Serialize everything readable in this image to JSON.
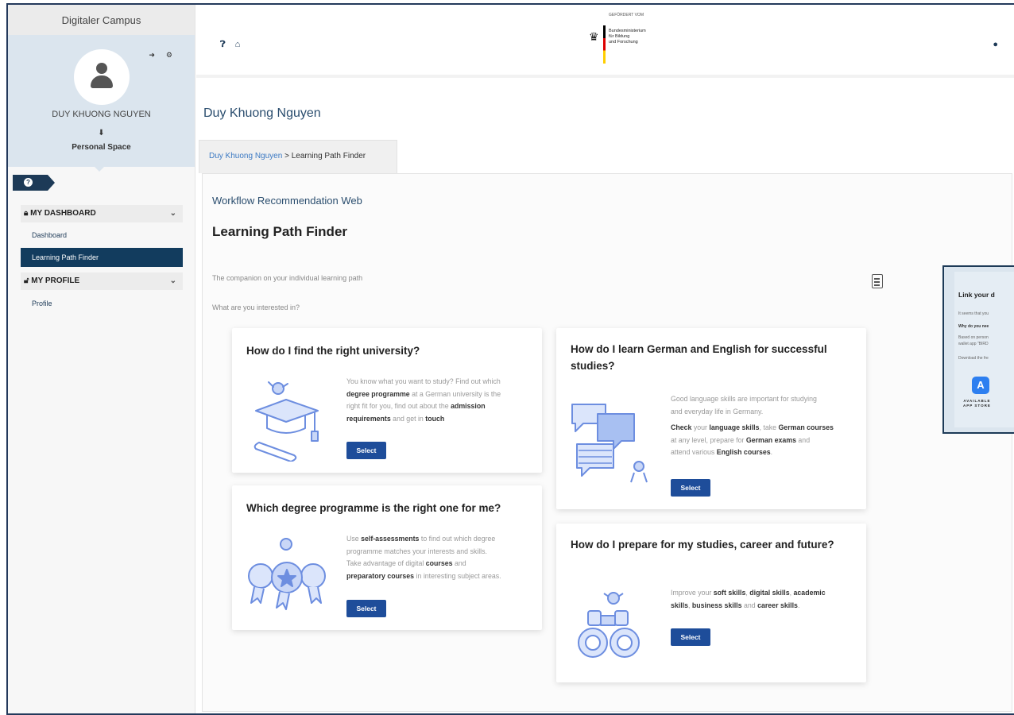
{
  "sidebar": {
    "campus_title": "Digitaler Campus",
    "user_name": "DUY KHUONG NGUYEN",
    "personal_space": "Personal Space",
    "my_dashboard": "MY DASHBOARD",
    "dashboard": "Dashboard",
    "learning_path_finder": "Learning Path Finder",
    "my_profile": "MY PROFILE",
    "profile": "Profile"
  },
  "header": {
    "sponsor_caption": "GEFÖRDERT VOM",
    "ministry_line1": "Bundesministerium",
    "ministry_line2": "für Bildung",
    "ministry_line3": "und Forschung"
  },
  "page": {
    "title": "Duy Khuong Nguyen",
    "breadcrumb_link": "Duy Khuong Nguyen",
    "breadcrumb_sep": " > ",
    "breadcrumb_current": "Learning Path Finder",
    "workflow_title": "Workflow Recommendation Web",
    "heading": "Learning Path Finder",
    "companion": "The companion on your individual learning path",
    "question": "What are you interested in?"
  },
  "cards": [
    {
      "title": "How do I find the right university?",
      "t1": "You know what you want to study? Find out which",
      "t2b": "degree programme",
      "t2": " at a German university is the",
      "t3": "right fit for you, find out about the ",
      "t3b": "admission",
      "t4b": "requirements",
      "t4": " and get in ",
      "t4c": "touch",
      "button": "Select"
    },
    {
      "title": "How do I learn German and English for successful studies?",
      "t1": "Good language skills are important for studying",
      "t2": "and everyday life in Germany.",
      "t3b": "Check",
      "t3": " your ",
      "t3c": "language skills",
      "t3d": ", take ",
      "t3e": "German courses",
      "t4": "at any level, prepare for ",
      "t4b": "German exams",
      "t4c": " and",
      "t5": "attend various ",
      "t5b": "English courses",
      "t5c": ".",
      "button": "Select"
    },
    {
      "title": "Which degree programme is the right one for me?",
      "t1": "Use ",
      "t1b": "self-assessments",
      "t1c": " to find out which degree",
      "t2": "programme matches your interests and skills.",
      "t3": "Take advantage of digital ",
      "t3b": "courses",
      "t3c": " and",
      "t4b": "preparatory courses",
      "t4": " in interesting subject areas.",
      "button": "Select"
    },
    {
      "title": "How do I prepare for my studies, career and future?",
      "t1": "Improve your ",
      "t1b": "soft skills",
      "t1c": ", ",
      "t1d": "digital skills",
      "t1e": ", ",
      "t1f": "academic",
      "t2b": "skills",
      "t2": ", ",
      "t2c": "business skills",
      "t2d": " and ",
      "t2e": "career skills",
      "t2f": ".",
      "button": "Select"
    }
  ],
  "wallet": {
    "title": "Link your d",
    "line1": "It seems that you",
    "line2": "Why do you nee",
    "line3": "Based on person",
    "line4": "wallet app \"BIRD",
    "line5": "Download the fre",
    "available": "AVAILABLE",
    "store": "APP STORE"
  },
  "colors": {
    "accent": "#1e4d9a",
    "nav_active": "#123c5e",
    "profile_bg": "#dbe5ee",
    "illustration": "#6d8ee0"
  }
}
